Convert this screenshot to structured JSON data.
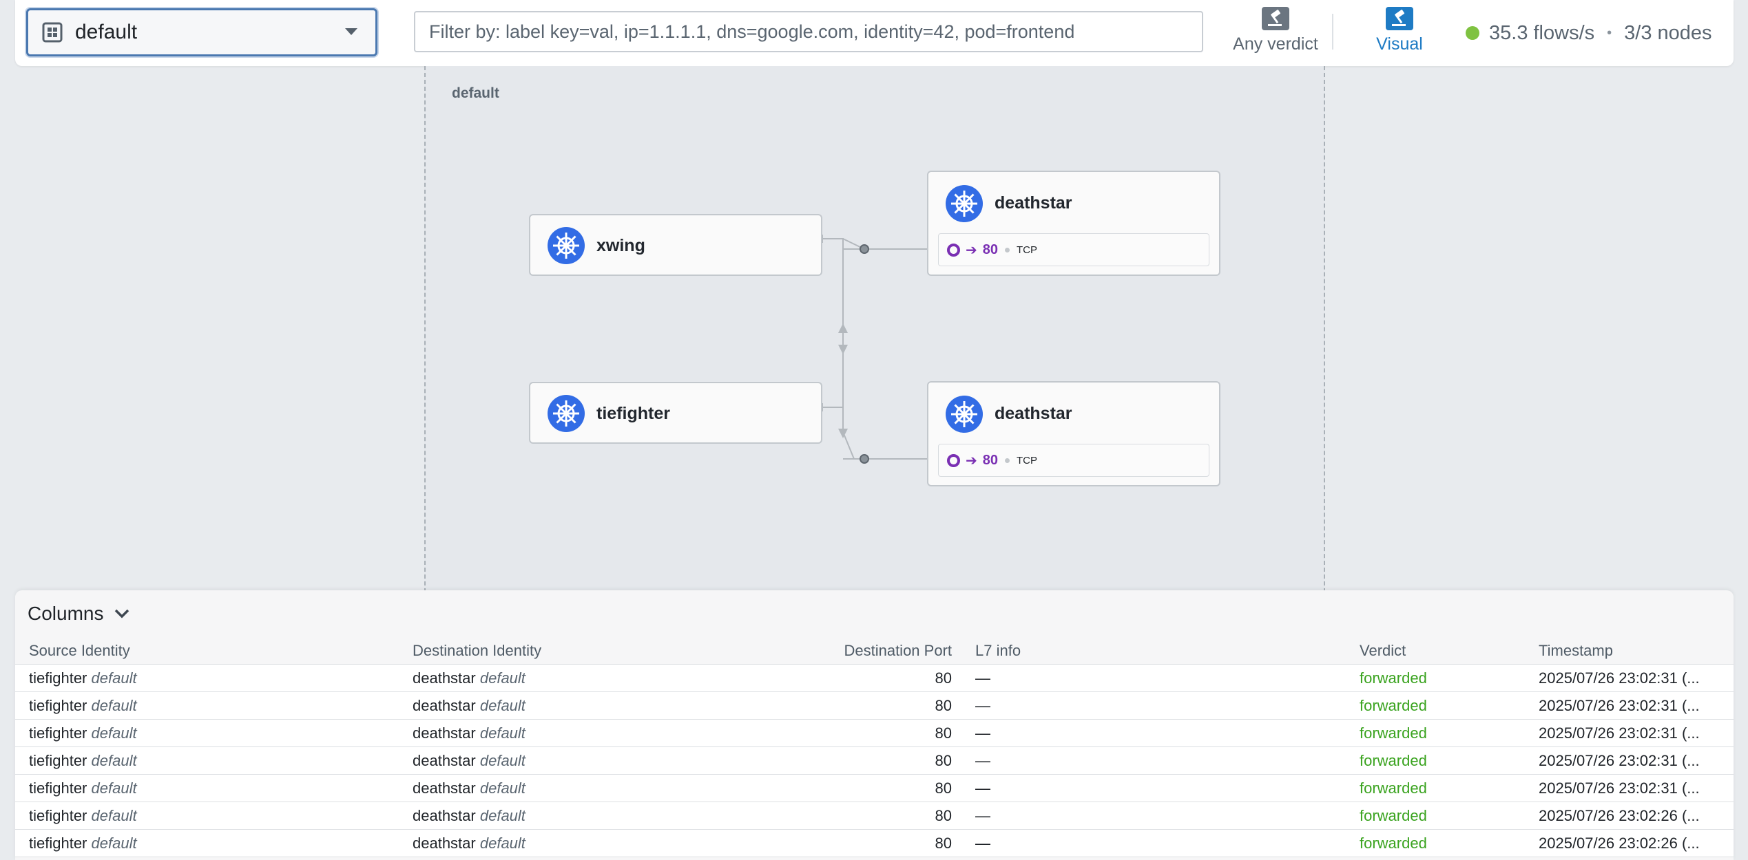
{
  "namespace_selector": {
    "value": "default",
    "icon": "namespace-icon"
  },
  "filter": {
    "placeholder": "Filter by: label key=val, ip=1.1.1.1, dns=google.com, identity=42, pod=frontend",
    "value": ""
  },
  "toolbar": {
    "verdict_label": "Any verdict",
    "visual_label": "Visual"
  },
  "status": {
    "flows_rate": "35.3 flows/s",
    "separator": "•",
    "nodes": "3/3 nodes",
    "indicator_color": "#7fc241"
  },
  "map": {
    "namespace_label": "default",
    "services": [
      {
        "name": "xwing",
        "icon": "kubernetes-icon"
      },
      {
        "name": "tiefighter",
        "icon": "kubernetes-icon"
      },
      {
        "name": "deathstar",
        "icon": "kubernetes-icon",
        "port": "80",
        "protocol": "TCP",
        "arrow": "➔"
      },
      {
        "name": "deathstar",
        "icon": "kubernetes-icon",
        "port": "80",
        "protocol": "TCP",
        "arrow": "➔"
      }
    ]
  },
  "flows": {
    "columns_label": "Columns",
    "headers": {
      "source": "Source Identity",
      "destination": "Destination Identity",
      "port": "Destination Port",
      "l7": "L7 info",
      "verdict": "Verdict",
      "timestamp": "Timestamp"
    },
    "rows": [
      {
        "src": "tiefighter",
        "src_ns": "default",
        "dst": "deathstar",
        "dst_ns": "default",
        "port": "80",
        "l7": "—",
        "verdict": "forwarded",
        "timestamp": "2025/07/26 23:02:31 (..."
      },
      {
        "src": "tiefighter",
        "src_ns": "default",
        "dst": "deathstar",
        "dst_ns": "default",
        "port": "80",
        "l7": "—",
        "verdict": "forwarded",
        "timestamp": "2025/07/26 23:02:31 (..."
      },
      {
        "src": "tiefighter",
        "src_ns": "default",
        "dst": "deathstar",
        "dst_ns": "default",
        "port": "80",
        "l7": "—",
        "verdict": "forwarded",
        "timestamp": "2025/07/26 23:02:31 (..."
      },
      {
        "src": "tiefighter",
        "src_ns": "default",
        "dst": "deathstar",
        "dst_ns": "default",
        "port": "80",
        "l7": "—",
        "verdict": "forwarded",
        "timestamp": "2025/07/26 23:02:31 (..."
      },
      {
        "src": "tiefighter",
        "src_ns": "default",
        "dst": "deathstar",
        "dst_ns": "default",
        "port": "80",
        "l7": "—",
        "verdict": "forwarded",
        "timestamp": "2025/07/26 23:02:31 (..."
      },
      {
        "src": "tiefighter",
        "src_ns": "default",
        "dst": "deathstar",
        "dst_ns": "default",
        "port": "80",
        "l7": "—",
        "verdict": "forwarded",
        "timestamp": "2025/07/26 23:02:26 (..."
      },
      {
        "src": "tiefighter",
        "src_ns": "default",
        "dst": "deathstar",
        "dst_ns": "default",
        "port": "80",
        "l7": "—",
        "verdict": "forwarded",
        "timestamp": "2025/07/26 23:02:26 (..."
      }
    ]
  },
  "colors": {
    "accent": "#1e7bc4",
    "forwarded": "#3aa31f",
    "port": "#7a2fb3",
    "kube": "#326ce5"
  }
}
